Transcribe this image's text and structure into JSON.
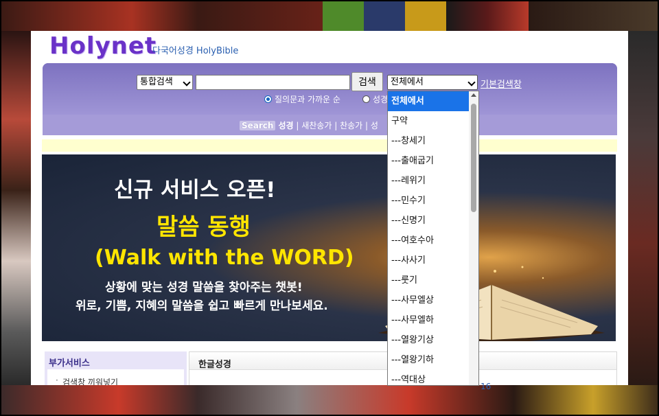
{
  "brand": {
    "logo": "Holynet",
    "subtitle": "다국어성경 HolyBible"
  },
  "search": {
    "mode_select": "통합검색",
    "input_value": "",
    "button_label": "검색",
    "scope_select": "전체에서",
    "basic_link": "기본검색창",
    "radio_1": "질의문과 가까운 순",
    "radio_2": "성경"
  },
  "nav": {
    "search_tag": "Search",
    "items": [
      "성경",
      "새찬송가",
      "찬송가",
      "성"
    ],
    "separator": " | "
  },
  "banner": {
    "line1": "신규 서비스 오픈!",
    "line2": "말씀 동행",
    "line3": "(Walk with the WORD)",
    "line4": "상황에 맞는 성경 말씀을 찾아주는 챗봇!",
    "line5": "위로, 기쁨, 지혜의 말씀을 쉽고 빠르게 만나보세요."
  },
  "sidebar": {
    "title": "부가서비스",
    "item": "검색창 끼워넣기"
  },
  "main_box": {
    "title": "한글성경"
  },
  "partial_link": "16",
  "dropdown": {
    "items": [
      "전체에서",
      "구약",
      "---창세기",
      "---출애굽기",
      "---레위기",
      "---민수기",
      "---신명기",
      "---여호수아",
      "---사사기",
      "---룻기",
      "---사무엘상",
      "---사무엘하",
      "---열왕기상",
      "---열왕기하",
      "---역대상"
    ],
    "selected_index": 0
  },
  "colors": {
    "brand_purple": "#6a32c8",
    "panel_purple": "#8c82c8",
    "selected_blue": "#1a73e8",
    "banner_yellow": "#ffe500"
  }
}
